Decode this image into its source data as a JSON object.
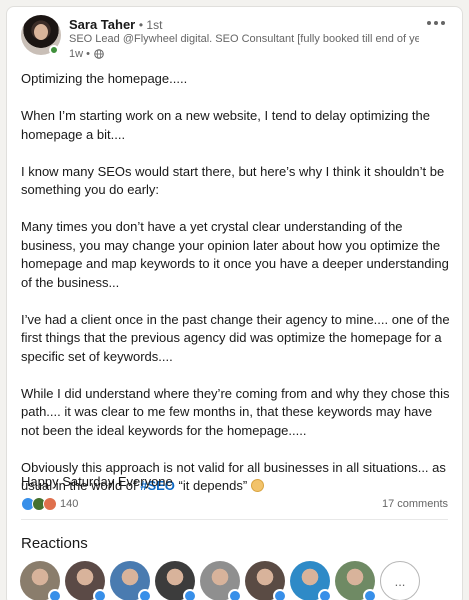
{
  "author": {
    "name": "Sara Taher",
    "degree": "• 1st",
    "headline": "SEO Lead @Flywheel digital. SEO Consultant [fully booked till end of ye...",
    "time": "1w •"
  },
  "post": {
    "paragraphs": [
      "Optimizing the homepage.....",
      "When I’m starting work on a new website, I tend to delay optimizing the homepage a bit....",
      "I know many SEOs would start there, but here’s why I think it shouldn’t be something you do early:",
      "Many times you don’t have a yet crystal clear understanding of the business, you may change your opinion later about how you optimize the homepage and map keywords to it once you have a deeper understanding of the business...",
      "I’ve had a client once in the past change their agency to mine.... one of the first things that the previous agency did was optimize the homepage for a specific set of keywords....",
      "While I did understand where they’re coming from and why they chose this path.... it was clear to me few months in, that these keywords may have not been the ideal keywords for the homepage....."
    ],
    "last_paragraph_before": "Obviously this approach is not valid for all businesses in all situations... as usual in the world of ",
    "hashtag": "#SEO",
    "last_paragraph_after": " “it depends” ",
    "closing": "Happy Saturday Everyone"
  },
  "social": {
    "reaction_count": "140",
    "comments": "17 comments",
    "reaction_types": [
      "like-icon",
      "celebrate-icon",
      "love-icon"
    ]
  },
  "reactions": {
    "title": "Reactions",
    "more_label": "...",
    "avatars": [
      {
        "name": "reactor-avatar-1",
        "color": "#8a7d6c"
      },
      {
        "name": "reactor-avatar-2",
        "color": "#5b4a46"
      },
      {
        "name": "reactor-avatar-3",
        "color": "#4a7bb0"
      },
      {
        "name": "reactor-avatar-4",
        "color": "#3c3c3c"
      },
      {
        "name": "reactor-avatar-5",
        "color": "#8f8f8f"
      },
      {
        "name": "reactor-avatar-6",
        "color": "#5a4b44"
      },
      {
        "name": "reactor-avatar-7",
        "color": "#2e8ac7"
      },
      {
        "name": "reactor-avatar-8",
        "color": "#6f8a64"
      }
    ]
  },
  "colors": {
    "link": "#0a66c2",
    "like": "#378fe9",
    "online": "#3f8f3a"
  }
}
